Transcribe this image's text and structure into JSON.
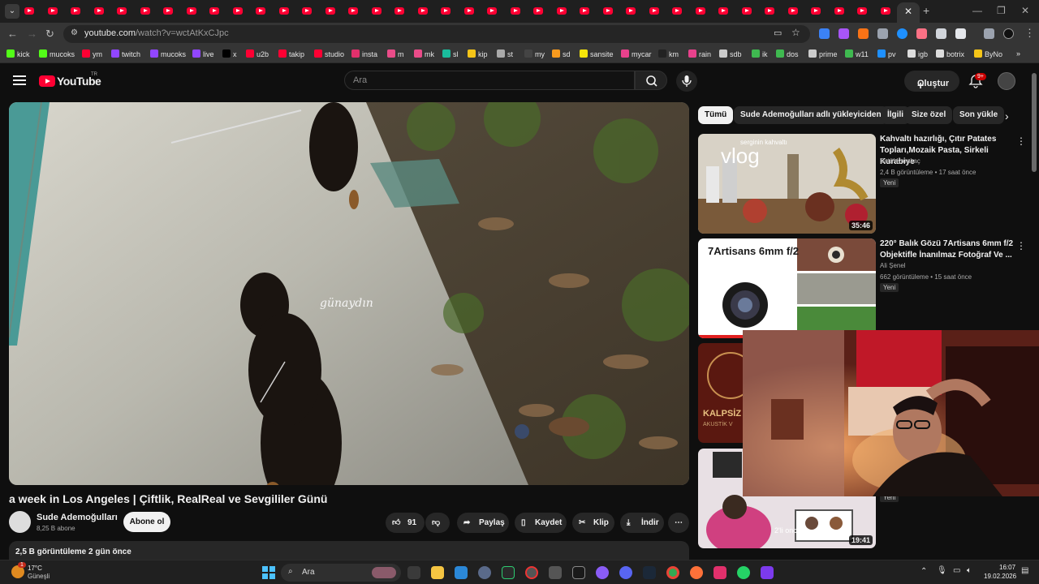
{
  "browser": {
    "url_host": "youtube.com",
    "url_path": "/watch?v=wctAtKxCJpc",
    "bookmarks": [
      {
        "label": "kick",
        "color": "#53fc18"
      },
      {
        "label": "mucoks",
        "color": "#53fc18"
      },
      {
        "label": "ym",
        "color": "#ff0033"
      },
      {
        "label": "twitch",
        "color": "#9146ff"
      },
      {
        "label": "mucoks",
        "color": "#9146ff"
      },
      {
        "label": "live",
        "color": "#9146ff"
      },
      {
        "label": "x",
        "color": "#000000"
      },
      {
        "label": "u2b",
        "color": "#ff0033"
      },
      {
        "label": "takip",
        "color": "#ff0033"
      },
      {
        "label": "studio",
        "color": "#ff0033"
      },
      {
        "label": "insta",
        "color": "#e1306c"
      },
      {
        "label": "m",
        "color": "#ea4c89"
      },
      {
        "label": "mk",
        "color": "#ea4c89"
      },
      {
        "label": "sl",
        "color": "#1abc9c"
      },
      {
        "label": "kip",
        "color": "#f5c518"
      },
      {
        "label": "st",
        "color": "#aaaaaa"
      },
      {
        "label": "my",
        "color": "#444444"
      },
      {
        "label": "sd",
        "color": "#f79a1e"
      },
      {
        "label": "sansite",
        "color": "#f5e50a"
      },
      {
        "label": "mycar",
        "color": "#e8418c"
      },
      {
        "label": "km",
        "color": "#222222"
      },
      {
        "label": "rain",
        "color": "#e8418c"
      },
      {
        "label": "sdb",
        "color": "#cccccc"
      },
      {
        "label": "ik",
        "color": "#3fb950"
      },
      {
        "label": "dos",
        "color": "#3fb950"
      },
      {
        "label": "prime",
        "color": "#cccccc"
      },
      {
        "label": "w11",
        "color": "#3fb950"
      },
      {
        "label": "pv",
        "color": "#1e90ff"
      },
      {
        "label": "igb",
        "color": "#dddddd"
      },
      {
        "label": "botrix",
        "color": "#dddddd"
      },
      {
        "label": "ByNo",
        "color": "#f5c518"
      }
    ]
  },
  "youtube": {
    "logo_text": "YouTube",
    "logo_region": "TR",
    "search_placeholder": "Ara",
    "create_label": "Oluştur",
    "notif_count": "9+"
  },
  "video": {
    "overlay_text": "günaydın",
    "title": "a week in Los Angeles | Çiftlik, RealReal ve Sevgililer Günü",
    "channel": "Sude Ademoğulları",
    "subscribers": "8,25 B abone",
    "subscribe_label": "Abone ol",
    "likes": "91",
    "share_label": "Paylaş",
    "save_label": "Kaydet",
    "clip_label": "Klip",
    "download_label": "İndir",
    "views_line": "2,5 B görüntüleme  2 gün önce"
  },
  "chips": [
    "Tümü",
    "Sude Ademoğulları adlı yükleyiciden",
    "İlgili",
    "Size özel",
    "Son yükle"
  ],
  "recommendations": [
    {
      "title": "Kahvaltı hazırlığı, Çıtır Patates Topları,Mozaik Pasta, Sirkeli Kurabiye",
      "channel": "Betül Karakaç",
      "meta": "2,4 B görüntüleme • 17 saat önce",
      "badge": "Yeni",
      "duration": "35:46",
      "thumb_text": "vlog",
      "thumb_small": "serginin kahvaltı"
    },
    {
      "title": "220° Balık Gözü 7Artisans 6mm f/2 Objektifle İnanılmaz Fotoğraf Ve ...",
      "channel": "Ali Şenel",
      "meta": "662 görüntüleme • 15 saat önce",
      "badge": "Yeni",
      "thumb_text": "7Artisans 6mm f/2"
    },
    {
      "thumb_text": "KALPSİZ Bİ",
      "thumb_small": "AKUSTİK V"
    },
    {
      "badge": "Yeni",
      "duration": "19:41",
      "thumb_small": "2'li oncü"
    }
  ],
  "taskbar": {
    "temp": "17°C",
    "weather": "Güneşli",
    "weather_badge": "1",
    "search": "Ara",
    "time": "16:07",
    "date": "19.02.2026"
  }
}
